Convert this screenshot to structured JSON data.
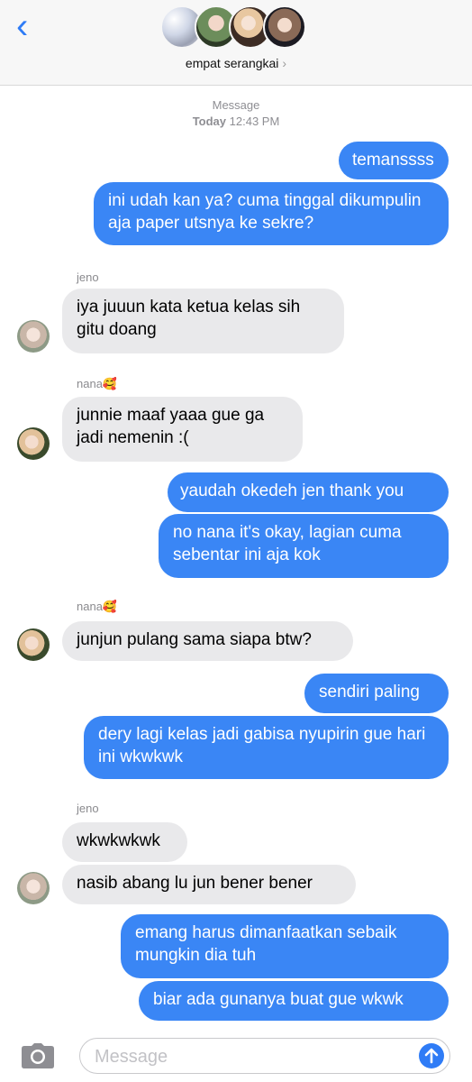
{
  "header": {
    "back_icon": "chevron-left-icon",
    "group_name": "empat serangkai",
    "chevron": "›"
  },
  "thread": {
    "service": "Message",
    "day": "Today",
    "time": "12:43 PM"
  },
  "messages": [
    {
      "side": "out",
      "text": "temanssss"
    },
    {
      "side": "out",
      "text": "ini udah kan ya? cuma tinggal dikumpulin aja paper utsnya ke sekre?"
    },
    {
      "side": "in",
      "sender": "jeno",
      "text": "iya juuun kata ketua kelas sih gitu doang"
    },
    {
      "side": "in",
      "sender": "nana🥰",
      "text": "junnie maaf yaaa gue ga jadi nemenin :("
    },
    {
      "side": "out",
      "text": "yaudah okedeh jen thank you"
    },
    {
      "side": "out",
      "text": "no nana it's okay, lagian cuma sebentar ini aja kok"
    },
    {
      "side": "in",
      "sender": "nana🥰",
      "text": "junjun pulang sama siapa btw?"
    },
    {
      "side": "out",
      "text": "sendiri paling"
    },
    {
      "side": "out",
      "text": "dery lagi kelas jadi gabisa nyupirin gue hari ini wkwkwk"
    },
    {
      "side": "in",
      "sender": "jeno",
      "text": "wkwkwkwk"
    },
    {
      "side": "in",
      "text": "nasib abang lu jun bener bener"
    },
    {
      "side": "out",
      "text": "emang harus dimanfaatkan sebaik mungkin dia tuh"
    },
    {
      "side": "out",
      "text": "biar ada gunanya buat gue wkwk"
    }
  ],
  "input": {
    "placeholder": "Message",
    "camera_icon": "camera-icon",
    "send_icon": "arrow-up-icon"
  },
  "colors": {
    "outgoing": "#3a86f5",
    "incoming": "#e9e9eb",
    "accent": "#2f7cf6"
  }
}
